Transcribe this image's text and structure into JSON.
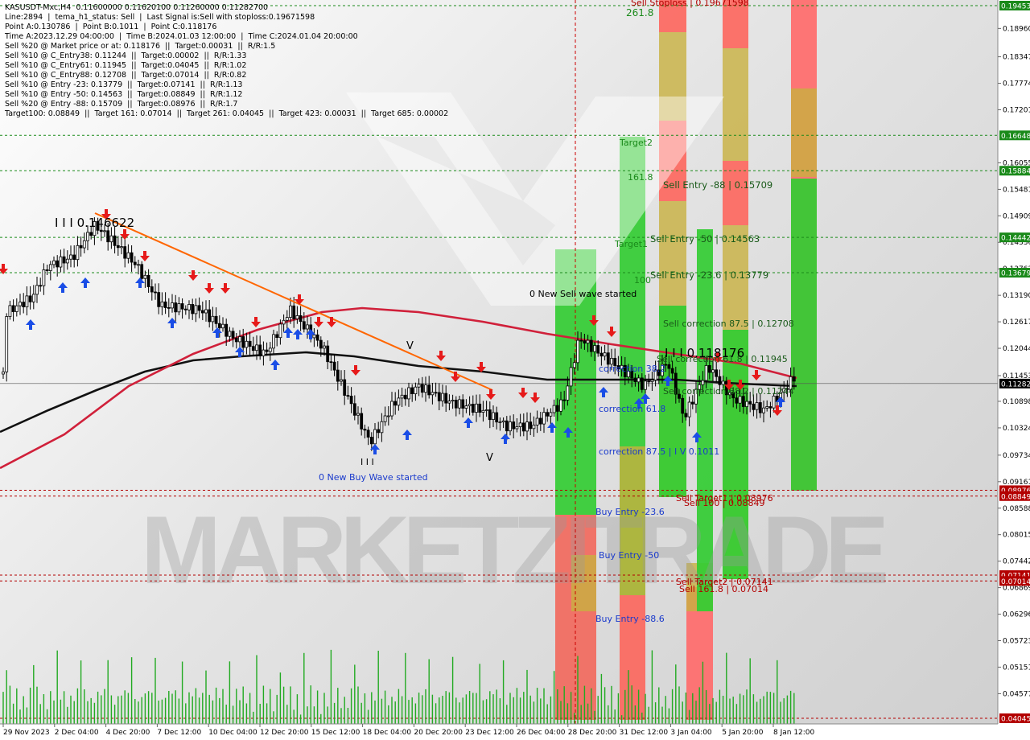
{
  "symbol_header": "KASUSDT-Mxc,H4  0.11600000 0.11620100 0.11260000 0.11282700",
  "info_lines": [
    "Line:2894  |  tema_h1_status: Sell  |  Last Signal is:Sell with stoploss:0.19671598",
    "Point A:0.130786  |  Point B:0.1011  |  Point C:0.118176",
    "Time A:2023.12.29 04:00:00  |  Time B:2024.01.03 12:00:00  |  Time C:2024.01.04 20:00:00",
    "Sell %20 @ Market price or at: 0.118176  ||  Target:0.00031  ||  R/R:1.5",
    "Sell %10 @ C_Entry38: 0.11244  ||  Target:0.00002  ||  R/R:1.33",
    "Sell %10 @ C_Entry61: 0.11945  ||  Target:0.04045  ||  R/R:1.02",
    "Sell %10 @ C_Entry88: 0.12708  ||  Target:0.07014  ||  R/R:0.82",
    "Sell %10 @ Entry -23: 0.13779  ||  Target:0.07141  ||  R/R:1.13",
    "Sell %10 @ Entry -50: 0.14563  ||  Target:0.08849  ||  R/R:1.12",
    "Sell %20 @ Entry -88: 0.15709  ||  Target:0.08976  ||  R/R:1.7",
    "Target100: 0.08849  ||  Target 161: 0.07014  ||  Target 261: 0.04045  ||  Target 423: 0.00031  ||  Target 685: 0.00002"
  ],
  "watermark": {
    "text": "MARKETZITRADE"
  },
  "colors": {
    "green": "#33cc33",
    "red": "#ff6b6b",
    "olive": "#c8b040",
    "ma_black": "#111111",
    "ma_red": "#d0203a",
    "trend": "#ff6600",
    "buy_arrow": "#1a4de6",
    "sell_arrow": "#e61a1a",
    "level_green": "#1a8a1a",
    "level_red": "#b30000"
  },
  "chart_data": {
    "type": "candlestick",
    "symbol": "KASUSDT-Mxc",
    "timeframe": "H4",
    "ohlc_last": {
      "open": 0.116,
      "high": 0.116201,
      "low": 0.1126,
      "close": 0.112827
    },
    "price_range": [
      0.0397,
      0.1965
    ],
    "x_labels": [
      "29 Nov 2023",
      "2 Dec 04:00",
      "4 Dec 20:00",
      "7 Dec 12:00",
      "10 Dec 04:00",
      "12 Dec 20:00",
      "15 Dec 12:00",
      "18 Dec 04:00",
      "20 Dec 20:00",
      "23 Dec 12:00",
      "26 Dec 04:00",
      "28 Dec 20:00",
      "31 Dec 12:00",
      "3 Jan 04:00",
      "5 Jan 20:00",
      "8 Jan 12:00"
    ],
    "y_ticks": [
      "0.18960",
      "0.18347",
      "0.17774",
      "0.17201",
      "0.16055",
      "0.15481",
      "0.14909",
      "0.14336",
      "0.13762",
      "0.13190",
      "0.12617",
      "0.12044",
      "0.11453",
      "0.10898",
      "0.10324",
      "0.09734",
      "0.09161",
      "0.08588",
      "0.08015",
      "0.07442",
      "0.06869",
      "0.06296",
      "0.05723",
      "0.05151",
      "0.04577"
    ],
    "price_tags": [
      {
        "label": "0.19453",
        "color": "#1a8a1a"
      },
      {
        "label": "0.16648",
        "color": "#1a8a1a"
      },
      {
        "label": "0.15884",
        "color": "#1a8a1a"
      },
      {
        "label": "0.14442",
        "color": "#1a8a1a"
      },
      {
        "label": "0.13679",
        "color": "#1a8a1a"
      },
      {
        "label": "0.11282",
        "color": "#000000"
      },
      {
        "label": "0.08976",
        "color": "#b30000"
      },
      {
        "label": "0.08849",
        "color": "#b30000"
      },
      {
        "label": "0.07141",
        "color": "#b30000"
      },
      {
        "label": "0.07014",
        "color": "#b30000"
      },
      {
        "label": "0.04045",
        "color": "#b30000"
      }
    ],
    "levels": [
      {
        "price": 0.19453,
        "color": "green"
      },
      {
        "price": 0.16648,
        "color": "green"
      },
      {
        "price": 0.15884,
        "color": "green"
      },
      {
        "price": 0.14442,
        "color": "green"
      },
      {
        "price": 0.13679,
        "color": "green"
      },
      {
        "price": 0.11282,
        "color": "gray"
      },
      {
        "price": 0.08976,
        "color": "red"
      },
      {
        "price": 0.08849,
        "color": "red"
      },
      {
        "price": 0.07141,
        "color": "red"
      },
      {
        "price": 0.07014,
        "color": "red"
      },
      {
        "price": 0.04045,
        "color": "red"
      }
    ],
    "labels": [
      {
        "text": "I I I 0.146622",
        "color": "#000000",
        "anchor": "peak"
      },
      {
        "text": "0 New Sell wave started",
        "color": "#000000"
      },
      {
        "text": "0 New Buy Wave started",
        "color": "#1a3acc"
      },
      {
        "text": "261.8",
        "color": "#1a8a1a"
      },
      {
        "text": "Target2",
        "color": "#1a8a1a"
      },
      {
        "text": "161.8",
        "color": "#1a8a1a"
      },
      {
        "text": "Target1",
        "color": "#1a8a1a"
      },
      {
        "text": "100",
        "color": "#1a8a1a"
      },
      {
        "text": "Sell Entry -88 | 0.15709",
        "color": "#1a5a1a"
      },
      {
        "text": "Sell Entry -50 | 0.14563",
        "color": "#1a5a1a"
      },
      {
        "text": "Sell Entry -23.6 | 0.13779",
        "color": "#1a5a1a"
      },
      {
        "text": "Sell correction 87.5 | 0.12708",
        "color": "#1a5a1a"
      },
      {
        "text": "Sell correction 61.8 | 0.11945",
        "color": "#1a5a1a"
      },
      {
        "text": "Sell correction 38.2 | 0.11244",
        "color": "#1a5a1a"
      },
      {
        "text": "I I I 0.118176",
        "color": "#000000"
      },
      {
        "text": "correction 38.2",
        "color": "#1a3acc"
      },
      {
        "text": "correction 61.8",
        "color": "#1a3acc"
      },
      {
        "text": "correction 87.5 | I V 0.1011",
        "color": "#1a3acc"
      },
      {
        "text": "Buy Entry -23.6",
        "color": "#1a3acc"
      },
      {
        "text": "Buy Entry -50",
        "color": "#1a3acc"
      },
      {
        "text": "Buy Entry -88.6",
        "color": "#1a3acc"
      },
      {
        "text": "Sell Target1 | 0.08976",
        "color": "#b30000"
      },
      {
        "text": "Sell 100 | 0.08849",
        "color": "#b30000"
      },
      {
        "text": "Sell Target2 | 0.07141",
        "color": "#b30000"
      },
      {
        "text": "Sell 161.8 | 0.07014",
        "color": "#b30000"
      },
      {
        "text": "Sell Stoploss | 0.19671598",
        "color": "#b30000"
      },
      {
        "text": "V",
        "color": "#000000"
      },
      {
        "text": "V",
        "color": "#000000"
      },
      {
        "text": "I I I",
        "color": "#000000"
      }
    ]
  }
}
